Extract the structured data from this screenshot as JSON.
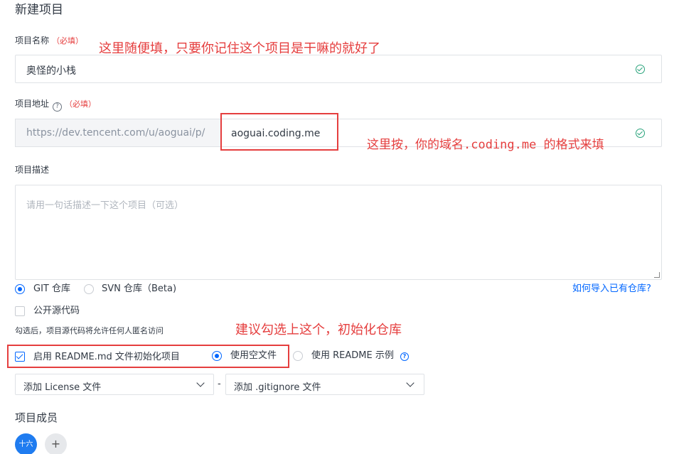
{
  "page": {
    "title": "新建项目"
  },
  "project_name": {
    "label": "项目名称",
    "required": "（必填）",
    "value": "奥怪的小栈"
  },
  "project_address": {
    "label": "项目地址",
    "help_icon": "?",
    "required": "（必填）",
    "prefix": "https://dev.tencent.com/u/aoguai/p/",
    "value": "aoguai.coding.me"
  },
  "project_description": {
    "label": "项目描述",
    "placeholder": "请用一句话描述一下这个项目（可选）"
  },
  "repo_type": {
    "options": [
      "GIT 仓库",
      "SVN 仓库（Beta)"
    ],
    "selected": "GIT 仓库",
    "import_link": "如何导入已有仓库?"
  },
  "open_source": {
    "label": "公开源代码",
    "checked": false,
    "hint": "勾选后，项目源代码将允许任何人匿名访问"
  },
  "readme": {
    "label": "启用 README.md 文件初始化项目",
    "checked": true,
    "options": [
      "使用空文件",
      "使用 README 示例"
    ],
    "selected": "使用空文件",
    "help_icon": "?"
  },
  "license_select": {
    "value": "添加 License 文件"
  },
  "separator": "-",
  "gitignore_select": {
    "value": "添加 .gitignore 文件"
  },
  "members": {
    "title": "项目成员",
    "avatar_label": "十六",
    "add_label": "+"
  },
  "annotations": {
    "name_note": "这里随便填，只要你记住这个项目是干嘛的就好了",
    "address_note": "这里按，你的域名.coding.me 的格式来填",
    "readme_note": "建议勾选上这个，初始化仓库"
  },
  "colors": {
    "accent": "#0066ff",
    "annotation_red": "#e53e3e",
    "valid_green": "#29a37b"
  }
}
